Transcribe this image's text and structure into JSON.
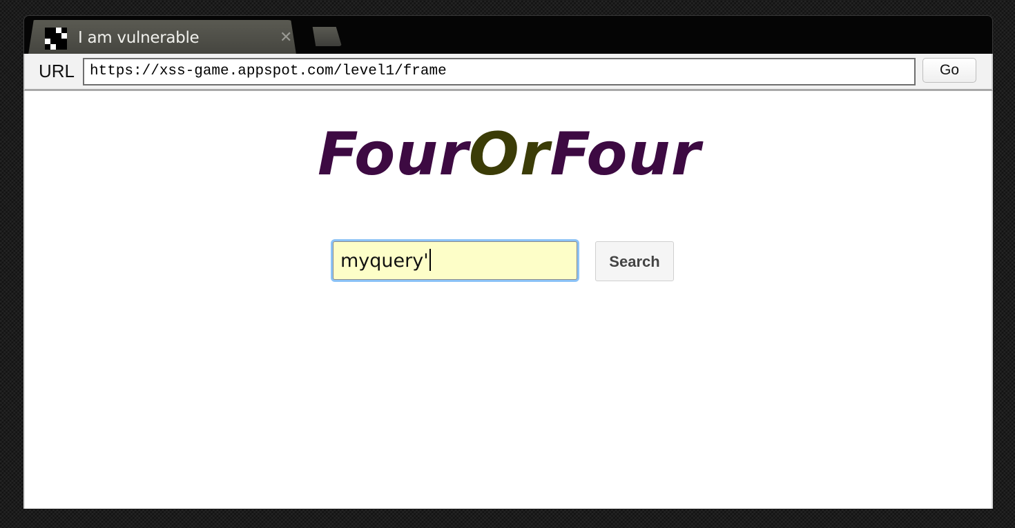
{
  "browser": {
    "tab": {
      "title": "I am vulnerable",
      "favicon": "checker-favicon-icon",
      "close_glyph": "✕"
    },
    "new_tab": "new-tab-icon",
    "address_bar": {
      "label": "URL",
      "url": "https://xss-game.appspot.com/level1/frame",
      "go_label": "Go"
    }
  },
  "page": {
    "logo": {
      "part1": "Four",
      "part2": "Or",
      "part3": "Four",
      "color_primary": "#3d0a42",
      "color_secondary": "#3b3c07"
    },
    "search": {
      "query": "myquery'",
      "button_label": "Search",
      "input_background": "#fdfec8",
      "focus_ring": "#8cc3f7"
    }
  }
}
